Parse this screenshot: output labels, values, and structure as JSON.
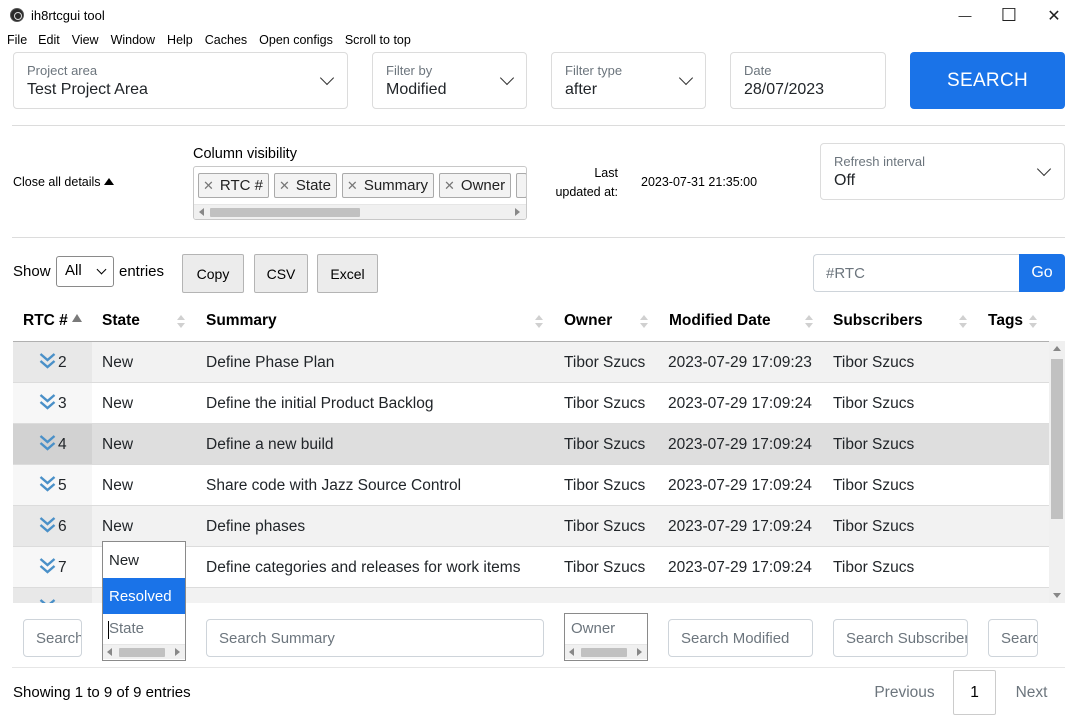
{
  "window": {
    "title": "ih8rtcgui tool",
    "minimize": "—",
    "maximize": "☐",
    "close": "✕"
  },
  "menu": [
    "File",
    "Edit",
    "View",
    "Window",
    "Help",
    "Caches",
    "Open configs",
    "Scroll to top"
  ],
  "filters": {
    "project_area": {
      "label": "Project area",
      "value": "Test Project Area"
    },
    "filter_by": {
      "label": "Filter by",
      "value": "Modified"
    },
    "filter_type": {
      "label": "Filter type",
      "value": "after"
    },
    "date": {
      "label": "Date",
      "value": "28/07/2023"
    },
    "search_label": "SEARCH"
  },
  "details": {
    "close_all": "Close all details",
    "column_visibility_label": "Column visibility",
    "columns": [
      "RTC #",
      "State",
      "Summary",
      "Owner"
    ],
    "last_updated_label": "Last updated at:",
    "last_updated_value": "2023-07-31 21:35:00",
    "refresh": {
      "label": "Refresh interval",
      "value": "Off"
    }
  },
  "toolbar": {
    "show_label": "Show",
    "show_value": "All",
    "entries_label": "entries",
    "copy": "Copy",
    "csv": "CSV",
    "excel": "Excel",
    "rtc_placeholder": "#RTC",
    "go": "Go"
  },
  "table": {
    "headers": [
      "RTC #",
      "State",
      "Summary",
      "Owner",
      "Modified Date",
      "Subscribers",
      "Tags"
    ],
    "rows": [
      {
        "id": "2",
        "state": "New",
        "summary": "Define Phase Plan",
        "owner": "Tibor Szucs",
        "modified": "2023-07-29 17:09:23",
        "subscribers": "Tibor Szucs",
        "tags": ""
      },
      {
        "id": "3",
        "state": "New",
        "summary": "Define the initial Product Backlog",
        "owner": "Tibor Szucs",
        "modified": "2023-07-29 17:09:24",
        "subscribers": "Tibor Szucs",
        "tags": ""
      },
      {
        "id": "4",
        "state": "New",
        "summary": "Define a new build",
        "owner": "Tibor Szucs",
        "modified": "2023-07-29 17:09:24",
        "subscribers": "Tibor Szucs",
        "tags": ""
      },
      {
        "id": "5",
        "state": "New",
        "summary": "Share code with Jazz Source Control",
        "owner": "Tibor Szucs",
        "modified": "2023-07-29 17:09:24",
        "subscribers": "Tibor Szucs",
        "tags": ""
      },
      {
        "id": "6",
        "state": "New",
        "summary": "Define phases",
        "owner": "Tibor Szucs",
        "modified": "2023-07-29 17:09:24",
        "subscribers": "Tibor Szucs",
        "tags": ""
      },
      {
        "id": "7",
        "state": "",
        "summary": "Define categories and releases for work items",
        "owner": "Tibor Szucs",
        "modified": "2023-07-29 17:09:24",
        "subscribers": "Tibor Szucs",
        "tags": ""
      }
    ]
  },
  "column_search": {
    "rtc": "Search",
    "state": "State",
    "summary": "Search Summary",
    "owner": "Owner",
    "modified": "Search Modified",
    "subscribers": "Search Subscribers",
    "tags": "Search Tags"
  },
  "state_dropdown": {
    "options": [
      "New",
      "Resolved"
    ],
    "selected": "Resolved"
  },
  "pagination": {
    "info": "Showing 1 to 9 of 9 entries",
    "previous": "Previous",
    "page": "1",
    "next": "Next"
  },
  "colors": {
    "accent": "#1a73e8",
    "chevron": "#4a90c8"
  }
}
